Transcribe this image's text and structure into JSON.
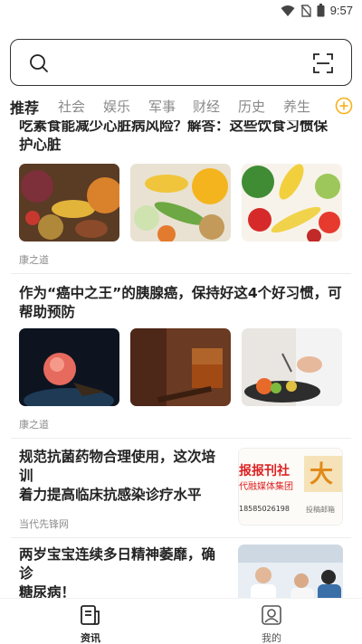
{
  "status_bar": {
    "time": "9:57",
    "icons": [
      "wifi-icon",
      "no-sim-icon",
      "battery-icon"
    ]
  },
  "search": {
    "placeholder": "",
    "left_icon": "search-icon",
    "right_icon": "scan-icon"
  },
  "tabs": [
    {
      "label": "推荐",
      "active": true
    },
    {
      "label": "社会",
      "active": false
    },
    {
      "label": "娱乐",
      "active": false
    },
    {
      "label": "军事",
      "active": false
    },
    {
      "label": "财经",
      "active": false
    },
    {
      "label": "历史",
      "active": false
    },
    {
      "label": "养生",
      "active": false
    }
  ],
  "tab_add_icon": "plus-circle-icon",
  "articles": [
    {
      "title_line1": "吃素食能减少心脏病风险？解答：这些饮食习惯保",
      "title_line2": "护心脏",
      "source": "康之道",
      "images": [
        "vegetables-basket",
        "corn-vegetables",
        "mixed-vegetables"
      ]
    },
    {
      "title_line1": "作为“癌中之王”的胰腺癌，保持好这4个好习惯，可",
      "title_line2": "帮助预防",
      "source": "康之道",
      "images": [
        "cell-illustration",
        "liquor-glass",
        "chef-cooking"
      ]
    },
    {
      "title_line1": "规范抗菌药物合理使用，这次培训",
      "title_line2": "着力提高临床抗感染诊疗水平",
      "source": "当代先锋网",
      "image_text": [
        "报报刊社",
        "代融媒体集团",
        "18585026198",
        "投稿邮箱",
        "大"
      ]
    },
    {
      "title_line1": "两岁宝宝连续多日精神萎靡，确诊",
      "title_line2": "糖尿病！",
      "image": "hospital-doctors"
    }
  ],
  "bottom_nav": [
    {
      "label": "资讯",
      "icon": "news-icon",
      "active": true
    },
    {
      "label": "我的",
      "icon": "profile-icon",
      "active": false
    }
  ],
  "colors": {
    "accent": "#f5b21b",
    "text": "#222222",
    "muted": "#8a8a8a"
  }
}
